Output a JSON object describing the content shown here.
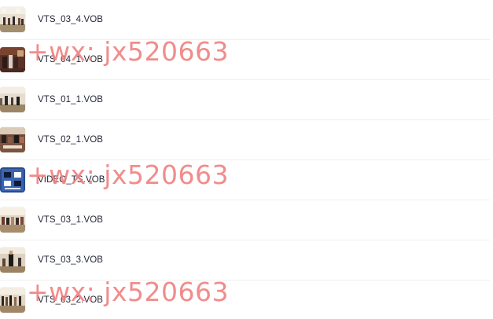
{
  "files": [
    {
      "name": "VTS_03_4.VOB",
      "thumb": "video-frame-wedding-hall"
    },
    {
      "name": "VTS_04_1.VOB",
      "thumb": "video-frame-dark-hall"
    },
    {
      "name": "VTS_01_1.VOB",
      "thumb": "video-frame-hall-speaker"
    },
    {
      "name": "VTS_02_1.VOB",
      "thumb": "video-frame-dinner-guests"
    },
    {
      "name": "VIDEO_TS.VOB",
      "thumb": "dvd-menu-frame"
    },
    {
      "name": "VTS_03_1.VOB",
      "thumb": "video-frame-banquet"
    },
    {
      "name": "VTS_03_3.VOB",
      "thumb": "video-frame-ceremony"
    },
    {
      "name": "VTS_03_2.VOB",
      "thumb": "video-frame-stage"
    }
  ],
  "watermarks": [
    {
      "text": "+wx: jx520663"
    },
    {
      "text": "+wx: jx520663"
    },
    {
      "text": "+wx: jx520663"
    }
  ],
  "colors": {
    "watermark": "#f08080",
    "text": "#1f2430",
    "divider": "#efefef"
  }
}
